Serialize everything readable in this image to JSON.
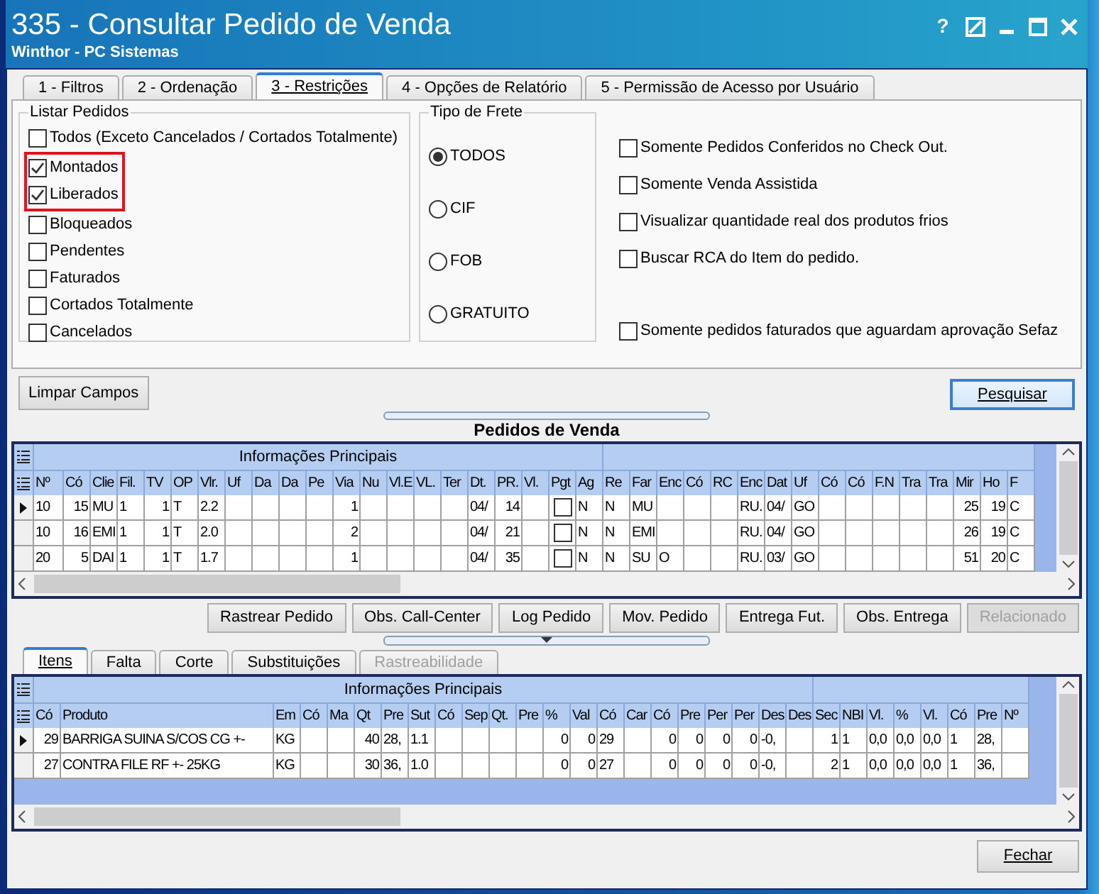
{
  "window": {
    "title": "335 - Consultar Pedido de Venda",
    "subtitle": "Winthor - PC Sistemas",
    "help": "?"
  },
  "tabs": [
    {
      "label": "1 - Filtros",
      "selected": false
    },
    {
      "label": "2 - Ordenação",
      "selected": false
    },
    {
      "label": "3 - Restrições",
      "selected": true
    },
    {
      "label": "4 - Opções de Relatório",
      "selected": false
    },
    {
      "label": "5 - Permissão de Acesso por Usuário",
      "selected": false
    }
  ],
  "listar_pedidos": {
    "title": "Listar Pedidos",
    "items": [
      {
        "label": "Todos (Exceto Cancelados / Cortados Totalmente)",
        "checked": false,
        "highlighted": false
      },
      {
        "label": "Montados",
        "checked": true,
        "highlighted": true
      },
      {
        "label": "Liberados",
        "checked": true,
        "highlighted": true
      },
      {
        "label": "Bloqueados",
        "checked": false,
        "highlighted": false
      },
      {
        "label": "Pendentes",
        "checked": false,
        "highlighted": false
      },
      {
        "label": "Faturados",
        "checked": false,
        "highlighted": false
      },
      {
        "label": "Cortados Totalmente",
        "checked": false,
        "highlighted": false
      },
      {
        "label": "Cancelados",
        "checked": false,
        "highlighted": false
      }
    ]
  },
  "tipo_de_frete": {
    "title": "Tipo de Frete",
    "options": [
      {
        "label": "TODOS",
        "selected": true
      },
      {
        "label": "CIF",
        "selected": false
      },
      {
        "label": "FOB",
        "selected": false
      },
      {
        "label": "GRATUITO",
        "selected": false
      }
    ]
  },
  "options": [
    {
      "label": "Somente Pedidos Conferidos no Check Out.",
      "checked": false
    },
    {
      "label": "Somente Venda Assistida",
      "checked": false
    },
    {
      "label": "Visualizar quantidade real dos produtos frios",
      "checked": false
    },
    {
      "label": "Buscar RCA do Item do pedido.",
      "checked": false
    },
    {
      "label": "Somente pedidos faturados que aguardam aprovação Sefaz",
      "checked": false
    }
  ],
  "limpar_button": "Limpar Campos",
  "pesquisar_button": "Pesquisar",
  "pedidos_grid": {
    "title": "Pedidos de Venda",
    "groups": [
      {
        "title": "Informações Principais",
        "columns": [
          {
            "label": "Nº",
            "kind": "text"
          },
          {
            "label": "Có",
            "kind": "number"
          },
          {
            "label": "Clie",
            "kind": "text"
          },
          {
            "label": "Fil.",
            "kind": "text"
          },
          {
            "label": "TV",
            "kind": "number"
          },
          {
            "label": "OP",
            "kind": "text"
          },
          {
            "label": "Vlr.",
            "kind": "text"
          },
          {
            "label": "Uf",
            "kind": "text"
          },
          {
            "label": "Da",
            "kind": "text"
          },
          {
            "label": "Da",
            "kind": "text"
          },
          {
            "label": "Pe",
            "kind": "text"
          },
          {
            "label": "Via",
            "kind": "number"
          },
          {
            "label": "Nu",
            "kind": "text"
          },
          {
            "label": "Vl.E",
            "kind": "text"
          },
          {
            "label": "VL.",
            "kind": "text"
          },
          {
            "label": "Ter",
            "kind": "text"
          },
          {
            "label": "Dt.",
            "kind": "text"
          },
          {
            "label": "PR.",
            "kind": "number"
          },
          {
            "label": "Vl.",
            "kind": "text"
          },
          {
            "label": "Pgt",
            "kind": "check"
          },
          {
            "label": "Ag",
            "kind": "text"
          }
        ]
      },
      {
        "columns": [
          {
            "label": "Re",
            "kind": "text"
          },
          {
            "label": "Far",
            "kind": "text"
          },
          {
            "label": "Enc",
            "kind": "text"
          },
          {
            "label": "Có",
            "kind": "text"
          },
          {
            "label": "RC",
            "kind": "text"
          },
          {
            "label": "Enc",
            "kind": "text"
          },
          {
            "label": "Dat",
            "kind": "text"
          },
          {
            "label": "Uf",
            "kind": "text"
          },
          {
            "label": "Có",
            "kind": "text"
          },
          {
            "label": "Có",
            "kind": "text"
          },
          {
            "label": "F.N",
            "kind": "text"
          },
          {
            "label": "Tra",
            "kind": "text"
          },
          {
            "label": "Tra",
            "kind": "text"
          },
          {
            "label": "Mir",
            "kind": "number"
          },
          {
            "label": "Ho",
            "kind": "number"
          },
          {
            "label": "F",
            "kind": "text"
          }
        ]
      }
    ],
    "rows": [
      {
        "selected": true,
        "cells": [
          "10",
          "15",
          "MU",
          "1",
          "1",
          "T",
          "2.2",
          null,
          null,
          null,
          null,
          "1",
          null,
          null,
          null,
          null,
          "04/",
          "14",
          null,
          false,
          "N",
          "N",
          "MU",
          null,
          null,
          null,
          "RU.",
          "04/",
          "GO",
          null,
          null,
          null,
          null,
          null,
          "25",
          "19",
          "C"
        ]
      },
      {
        "selected": false,
        "cells": [
          "10",
          "16",
          "EMI",
          "1",
          "1",
          "T",
          "2.0",
          null,
          null,
          null,
          null,
          "2",
          null,
          null,
          null,
          null,
          "04/",
          "21",
          null,
          false,
          "N",
          "N",
          "EMI",
          null,
          null,
          null,
          "RU.",
          "04/",
          "GO",
          null,
          null,
          null,
          null,
          null,
          "26",
          "19",
          "C"
        ]
      },
      {
        "selected": false,
        "cells": [
          "20",
          "5",
          "DAI",
          "1",
          "1",
          "T",
          "1.7",
          null,
          null,
          null,
          null,
          "1",
          null,
          null,
          null,
          null,
          "04/",
          "35",
          null,
          false,
          "N",
          "N",
          "SU",
          "O",
          null,
          null,
          "RU.",
          "03/",
          "GO",
          null,
          null,
          null,
          null,
          null,
          "51",
          "20",
          "C"
        ]
      }
    ]
  },
  "action_buttons": [
    {
      "label": "Rastrear Pedido",
      "disabled": false
    },
    {
      "label": "Obs. Call-Center",
      "disabled": false
    },
    {
      "label": "Log Pedido",
      "disabled": false
    },
    {
      "label": "Mov. Pedido",
      "disabled": false
    },
    {
      "label": "Entrega Fut.",
      "disabled": false
    },
    {
      "label": "Obs. Entrega",
      "disabled": false
    },
    {
      "label": "Relacionado",
      "disabled": true
    }
  ],
  "item_tabs": [
    {
      "label": "Itens",
      "selected": true,
      "disabled": false
    },
    {
      "label": "Falta",
      "selected": false,
      "disabled": false
    },
    {
      "label": "Corte",
      "selected": false,
      "disabled": false
    },
    {
      "label": "Substituições",
      "selected": false,
      "disabled": false
    },
    {
      "label": "Rastreabilidade",
      "selected": false,
      "disabled": true
    }
  ],
  "itens_grid": {
    "groups": [
      {
        "title": "Informações Principais",
        "columns": [
          {
            "label": "Có",
            "kind": "number"
          },
          {
            "label": "Produto",
            "kind": "wide"
          },
          {
            "label": "Em",
            "kind": "text"
          },
          {
            "label": "Có",
            "kind": "text"
          },
          {
            "label": "Ma",
            "kind": "text"
          },
          {
            "label": "Qt",
            "kind": "number"
          },
          {
            "label": "Pre",
            "kind": "text"
          },
          {
            "label": "Sut",
            "kind": "text"
          },
          {
            "label": "Có",
            "kind": "text"
          },
          {
            "label": "Sep",
            "kind": "text"
          },
          {
            "label": "Qt.",
            "kind": "text"
          },
          {
            "label": "Pre",
            "kind": "text"
          },
          {
            "label": "%",
            "kind": "number"
          },
          {
            "label": "Val",
            "kind": "number"
          },
          {
            "label": "Có",
            "kind": "text"
          },
          {
            "label": "Car",
            "kind": "text"
          },
          {
            "label": "Có",
            "kind": "number"
          },
          {
            "label": "Pre",
            "kind": "number"
          },
          {
            "label": "Per",
            "kind": "number"
          },
          {
            "label": "Per",
            "kind": "number"
          },
          {
            "label": "Des",
            "kind": "text"
          },
          {
            "label": "Des",
            "kind": "text"
          }
        ]
      },
      {
        "columns": [
          {
            "label": "Sec",
            "kind": "number"
          },
          {
            "label": "NBI",
            "kind": "text"
          },
          {
            "label": "Vl.",
            "kind": "text"
          },
          {
            "label": "%",
            "kind": "text"
          },
          {
            "label": "Vl.",
            "kind": "text"
          },
          {
            "label": "Có",
            "kind": "text"
          },
          {
            "label": "Pre",
            "kind": "text"
          },
          {
            "label": "Nº",
            "kind": "text"
          }
        ]
      }
    ],
    "rows": [
      {
        "selected": true,
        "cells": [
          "29",
          "BARRIGA SUINA S/COS CG +-",
          "KG",
          null,
          null,
          "40",
          "28,",
          "1.1",
          null,
          null,
          null,
          null,
          "0",
          "0",
          "29",
          null,
          "0",
          "0",
          "0",
          "0",
          "-0,",
          null,
          "1",
          "1",
          "0,0",
          "0,0",
          "0,0",
          "1",
          "28,",
          null
        ]
      },
      {
        "selected": false,
        "cells": [
          "27",
          "CONTRA FILE RF +- 25KG",
          "KG",
          null,
          null,
          "30",
          "36,",
          "1.0",
          null,
          null,
          null,
          null,
          "0",
          "0",
          "27",
          null,
          "0",
          "0",
          "0",
          "0",
          "-0,",
          null,
          "2",
          "1",
          "0,0",
          "0,0",
          "0,0",
          "1",
          "36,",
          null
        ]
      }
    ]
  },
  "fechar_button": "Fechar"
}
